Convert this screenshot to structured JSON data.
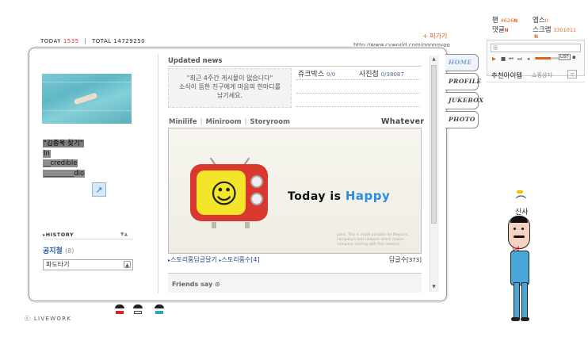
{
  "header": {
    "today_label": "TODAY",
    "today_count": "1535",
    "total_label": "TOTAL",
    "total_count": "14729250",
    "url": "http://www.cyworld.com/ggongyoo",
    "follow_label": "+ 퍼가기"
  },
  "profile": {
    "intro_lines": [
      "\"김종욱 찾기\"",
      "In",
      "__credible",
      "_________dio"
    ],
    "edit_glyph": "↗",
    "history_label": "HISTORY",
    "history_arrows": "▼▲",
    "notice_label": "공지철",
    "notice_count": "(8)",
    "select_value": "파도타기",
    "select_btn": "▲"
  },
  "news": {
    "title": "Updated news",
    "empty_lines": [
      "\"최근 4주간 게시물이 없습니다\"",
      "소식이 뜸한 친구에게 마음의 한마디를",
      "남기세요."
    ],
    "jukebox_label": "쥬크박스",
    "jukebox_count": "0/0",
    "photo_label": "사진첩",
    "photo_count": "0/38087"
  },
  "mini_tabs": {
    "minilife": "Minilife",
    "miniroom": "Miniroom",
    "storyroom": "Storyroom",
    "whatever": "Whatever"
  },
  "miniroom": {
    "face": "☺",
    "today_text": "Today is",
    "happy_text": "Happy",
    "fine_print": "poris. This is made possible by theporis. company's test network which makes company sharing with Fisk network."
  },
  "story": {
    "link1": "스토리룸답글달기",
    "link2": "스토리룸수[4]",
    "reply_label": "답글수",
    "reply_count": "[373]"
  },
  "friends": {
    "label": "Friends say ⊙"
  },
  "side_tabs": [
    "HOME",
    "PROFILE",
    "JUKEBOX",
    "PHOTO"
  ],
  "right_panel": {
    "fan_label": "팬",
    "fan_count": "4626",
    "app_label": "앱스",
    "app_count": "0",
    "comment_label": "댓글",
    "scrap_label": "스크랩",
    "scrap_count": "3301011",
    "new_badge": "N",
    "player_text": "◎",
    "list_label": "LIST",
    "rec_label": "추천아이템",
    "rec_sub": "쇼핑상자",
    "rec_btn": "▽"
  },
  "character": {
    "name": "신사"
  },
  "footer": {
    "brand": "ⓒ LIVEWORK",
    "mini_icons": [
      "mini-1",
      "mini-2",
      "mini-3"
    ]
  }
}
